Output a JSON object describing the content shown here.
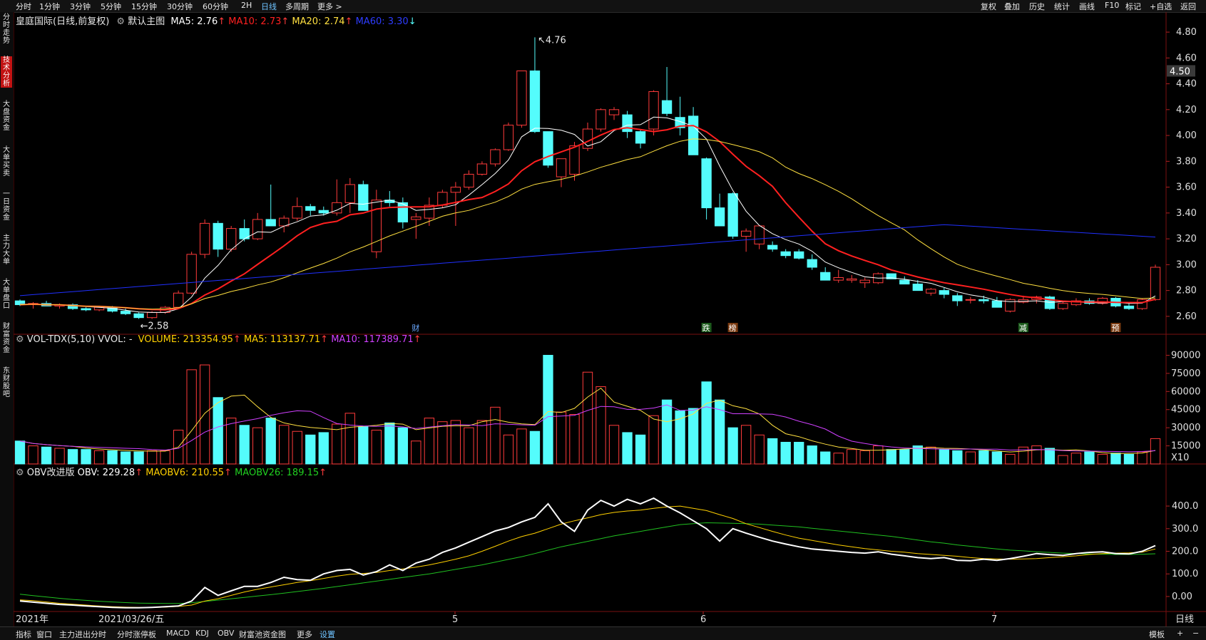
{
  "toolbar": {
    "tabs": [
      "分时",
      "1分钟",
      "3分钟",
      "5分钟",
      "15分钟",
      "30分钟",
      "60分钟",
      "2H",
      "日线",
      "多周期",
      "更多 >"
    ],
    "active": "日线",
    "right": [
      "复权",
      "叠加",
      "历史",
      "统计",
      "画线",
      "F10",
      "标记",
      "+自选",
      "返回"
    ]
  },
  "sidebar": {
    "items": [
      "分时走势",
      "技术分析",
      "大盘资金",
      "大单买卖",
      "一日资金",
      "主力大单",
      "大单盘口",
      "财富资金",
      "东财股吧"
    ],
    "active": "技术分析"
  },
  "main_panel": {
    "title": "皇庭国际(日线,前复权)",
    "subtitle": "默认主图",
    "ma5": "MA5: 2.76",
    "ma10": "MA10: 2.73",
    "ma20": "MA20: 2.74",
    "ma60": "MA60: 3.30",
    "high_label": "4.76",
    "low_label": "2.58",
    "price_ticks": [
      "4.80",
      "4.60",
      "4.40",
      "4.20",
      "4.00",
      "3.80",
      "3.60",
      "3.40",
      "3.20",
      "3.00",
      "2.80",
      "2.60"
    ],
    "last_price": "4.50",
    "events": [
      "财",
      "跌",
      "榜",
      "减",
      "预"
    ]
  },
  "volume_panel": {
    "title": "VOL-TDX(5,10) VVOL: -",
    "volume": "VOLUME: 213354.95",
    "ma5": "MA5: 113137.71",
    "ma10": "MA10: 117389.71",
    "ticks": [
      "90000",
      "75000",
      "60000",
      "45000",
      "30000",
      "15000"
    ],
    "unit": "X10"
  },
  "obv_panel": {
    "title": "OBV改进版",
    "obv": "OBV: 229.28",
    "maobv6": "MAOBV6: 210.55",
    "maobv26": "MAOBV26: 189.15",
    "ticks": [
      "400.0",
      "300.0",
      "200.0",
      "100.0",
      "0.00"
    ]
  },
  "date_axis": {
    "labels": [
      "2021年",
      "2021/03/26/五",
      "5",
      "6",
      "7"
    ],
    "period": "日线"
  },
  "bottom": {
    "left": [
      "指标",
      "窗口",
      "主力进出分时",
      "分时涨停板",
      "MACD",
      "KDJ",
      "OBV",
      "财富池资金图",
      "更多",
      "设置"
    ],
    "active": "设置",
    "right": [
      "模板",
      "+",
      "−"
    ]
  },
  "colors": {
    "up": "#ff3b3b",
    "down": "#54fcfc",
    "ma5": "#ffffff",
    "ma10": "#ff2020",
    "ma20": "#ffe040",
    "ma60": "#2030ff",
    "obv": "#ffffff",
    "maobv6": "#ffd000",
    "maobv26": "#20c020",
    "vol_ma10": "#d040ff",
    "background": "#000000"
  },
  "chart_data": {
    "type": "candlestick",
    "ohlc": [
      [
        2.72,
        2.73,
        2.68,
        2.69
      ],
      [
        2.69,
        2.71,
        2.66,
        2.7
      ],
      [
        2.7,
        2.72,
        2.68,
        2.68
      ],
      [
        2.68,
        2.7,
        2.66,
        2.69
      ],
      [
        2.69,
        2.7,
        2.65,
        2.66
      ],
      [
        2.66,
        2.67,
        2.64,
        2.65
      ],
      [
        2.65,
        2.68,
        2.64,
        2.67
      ],
      [
        2.67,
        2.68,
        2.63,
        2.64
      ],
      [
        2.64,
        2.66,
        2.61,
        2.62
      ],
      [
        2.62,
        2.63,
        2.58,
        2.59
      ],
      [
        2.59,
        2.64,
        2.58,
        2.63
      ],
      [
        2.63,
        2.68,
        2.62,
        2.67
      ],
      [
        2.67,
        2.8,
        2.66,
        2.78
      ],
      [
        2.78,
        3.1,
        2.77,
        3.08
      ],
      [
        3.08,
        3.35,
        3.05,
        3.32
      ],
      [
        3.32,
        3.34,
        3.06,
        3.12
      ],
      [
        3.12,
        3.3,
        3.1,
        3.28
      ],
      [
        3.28,
        3.35,
        3.18,
        3.2
      ],
      [
        3.2,
        3.4,
        3.19,
        3.35
      ],
      [
        3.35,
        3.62,
        3.3,
        3.3
      ],
      [
        3.3,
        3.38,
        3.25,
        3.36
      ],
      [
        3.36,
        3.52,
        3.34,
        3.45
      ],
      [
        3.45,
        3.47,
        3.38,
        3.42
      ],
      [
        3.42,
        3.45,
        3.38,
        3.4
      ],
      [
        3.4,
        3.66,
        3.38,
        3.48
      ],
      [
        3.48,
        3.67,
        3.4,
        3.62
      ],
      [
        3.62,
        3.65,
        3.42,
        3.42
      ],
      [
        3.1,
        3.58,
        3.05,
        3.5
      ],
      [
        3.5,
        3.57,
        3.45,
        3.48
      ],
      [
        3.48,
        3.52,
        3.28,
        3.33
      ],
      [
        3.35,
        3.4,
        3.2,
        3.37
      ],
      [
        3.36,
        3.52,
        3.3,
        3.46
      ],
      [
        3.46,
        3.58,
        3.44,
        3.56
      ],
      [
        3.56,
        3.64,
        3.3,
        3.6
      ],
      [
        3.6,
        3.73,
        3.58,
        3.7
      ],
      [
        3.7,
        3.8,
        3.69,
        3.78
      ],
      [
        3.78,
        3.9,
        3.76,
        3.89
      ],
      [
        3.89,
        4.1,
        3.88,
        4.08
      ],
      [
        4.08,
        4.5,
        4.06,
        4.5
      ],
      [
        4.5,
        4.76,
        4.02,
        4.03
      ],
      [
        4.03,
        4.03,
        3.75,
        3.77
      ],
      [
        3.68,
        3.8,
        3.6,
        3.82
      ],
      [
        3.7,
        3.95,
        3.65,
        3.92
      ],
      [
        3.9,
        4.1,
        3.88,
        4.05
      ],
      [
        4.05,
        4.21,
        4.03,
        4.2
      ],
      [
        4.16,
        4.22,
        4.12,
        4.2
      ],
      [
        4.16,
        4.19,
        3.98,
        4.03
      ],
      [
        4.03,
        4.05,
        3.9,
        3.94
      ],
      [
        4.05,
        4.35,
        4.0,
        4.34
      ],
      [
        4.27,
        4.53,
        4.15,
        4.17
      ],
      [
        4.14,
        4.3,
        4.0,
        4.06
      ],
      [
        4.15,
        4.22,
        3.85,
        3.85
      ],
      [
        3.82,
        3.83,
        3.35,
        3.44
      ],
      [
        3.44,
        3.55,
        3.3,
        3.3
      ],
      [
        3.55,
        3.56,
        3.2,
        3.22
      ],
      [
        3.22,
        3.28,
        3.1,
        3.26
      ],
      [
        3.16,
        3.3,
        3.12,
        3.3
      ],
      [
        3.15,
        3.18,
        3.1,
        3.12
      ],
      [
        3.1,
        3.12,
        3.05,
        3.07
      ],
      [
        3.1,
        3.12,
        3.04,
        3.05
      ],
      [
        3.04,
        3.08,
        2.96,
        2.98
      ],
      [
        2.94,
        2.98,
        2.88,
        2.88
      ],
      [
        2.88,
        2.96,
        2.86,
        2.9
      ],
      [
        2.88,
        2.92,
        2.86,
        2.89
      ],
      [
        2.86,
        2.9,
        2.82,
        2.88
      ],
      [
        2.86,
        2.94,
        2.85,
        2.93
      ],
      [
        2.93,
        2.93,
        2.89,
        2.89
      ],
      [
        2.88,
        2.91,
        2.85,
        2.85
      ],
      [
        2.85,
        2.88,
        2.8,
        2.8
      ],
      [
        2.78,
        2.82,
        2.76,
        2.81
      ],
      [
        2.8,
        2.82,
        2.74,
        2.77
      ],
      [
        2.76,
        2.78,
        2.68,
        2.72
      ],
      [
        2.73,
        2.75,
        2.7,
        2.73
      ],
      [
        2.73,
        2.76,
        2.7,
        2.72
      ],
      [
        2.72,
        2.75,
        2.67,
        2.67
      ],
      [
        2.64,
        2.74,
        2.63,
        2.73
      ],
      [
        2.71,
        2.76,
        2.7,
        2.73
      ],
      [
        2.73,
        2.76,
        2.7,
        2.75
      ],
      [
        2.75,
        2.76,
        2.65,
        2.66
      ],
      [
        2.66,
        2.72,
        2.65,
        2.7
      ],
      [
        2.69,
        2.74,
        2.68,
        2.72
      ],
      [
        2.72,
        2.74,
        2.69,
        2.7
      ],
      [
        2.7,
        2.75,
        2.69,
        2.74
      ],
      [
        2.74,
        2.75,
        2.67,
        2.68
      ],
      [
        2.68,
        2.7,
        2.65,
        2.66
      ],
      [
        2.66,
        2.74,
        2.65,
        2.73
      ],
      [
        2.73,
        3.0,
        2.72,
        2.98
      ]
    ],
    "volume": [
      19000,
      15000,
      14000,
      13000,
      12000,
      12000,
      11000,
      11000,
      10000,
      10000,
      11000,
      11000,
      28000,
      78000,
      82000,
      55000,
      38000,
      32000,
      30000,
      38000,
      32000,
      27000,
      24000,
      26000,
      33000,
      42000,
      31000,
      28000,
      34000,
      30000,
      19000,
      38000,
      35000,
      36000,
      30000,
      36000,
      47000,
      24000,
      29000,
      27000,
      90000,
      43000,
      41000,
      76000,
      64000,
      32000,
      26000,
      24000,
      40000,
      53000,
      44000,
      46000,
      68000,
      53000,
      30000,
      32000,
      24000,
      21000,
      18000,
      18000,
      15000,
      10000,
      9000,
      12000,
      11000,
      15000,
      12000,
      12000,
      15000,
      14000,
      12000,
      11000,
      10000,
      11000,
      10000,
      8000,
      14000,
      15000,
      13000,
      7000,
      9000,
      10000,
      8000,
      9000,
      8000,
      10000,
      21000
    ],
    "ma_lines": [
      "MA5",
      "MA10",
      "MA20",
      "MA60"
    ],
    "y_range": [
      2.5,
      4.85
    ],
    "volume_range": [
      0,
      95000
    ],
    "obv_range": [
      -60,
      520
    ],
    "obv": [
      -20,
      -25,
      -30,
      -35,
      -38,
      -42,
      -45,
      -48,
      -50,
      -50,
      -48,
      -45,
      -42,
      -20,
      40,
      5,
      25,
      45,
      45,
      62,
      85,
      75,
      72,
      100,
      115,
      120,
      95,
      110,
      140,
      115,
      148,
      165,
      195,
      215,
      240,
      265,
      290,
      305,
      330,
      350,
      410,
      330,
      288,
      382,
      425,
      400,
      430,
      410,
      435,
      400,
      370,
      335,
      300,
      245,
      300,
      280,
      262,
      245,
      232,
      220,
      210,
      205,
      200,
      195,
      192,
      198,
      187,
      180,
      172,
      168,
      172,
      160,
      158,
      165,
      160,
      168,
      178,
      190,
      185,
      182,
      190,
      195,
      198,
      190,
      188,
      200,
      225
    ],
    "maobv6": [
      -15,
      -18,
      -24,
      -30,
      -34,
      -38,
      -42,
      -45,
      -47,
      -48,
      -49,
      -47,
      -44,
      -38,
      -20,
      -10,
      5,
      20,
      32,
      42,
      52,
      62,
      70,
      80,
      90,
      98,
      102,
      106,
      115,
      122,
      130,
      140,
      152,
      165,
      180,
      200,
      222,
      245,
      265,
      280,
      300,
      320,
      335,
      348,
      362,
      372,
      378,
      382,
      390,
      396,
      400,
      390,
      380,
      362,
      345,
      322,
      305,
      288,
      272,
      258,
      248,
      238,
      228,
      220,
      212,
      206,
      200,
      196,
      190,
      186,
      182,
      178,
      172,
      168,
      166,
      165,
      166,
      168,
      172,
      176,
      180,
      186,
      190,
      192,
      193,
      196,
      210
    ],
    "maobv26": [
      10,
      4,
      -2,
      -8,
      -13,
      -17,
      -21,
      -24,
      -27,
      -29,
      -30,
      -31,
      -31,
      -28,
      -22,
      -16,
      -10,
      -4,
      2,
      8,
      15,
      22,
      29,
      36,
      44,
      52,
      60,
      68,
      76,
      84,
      92,
      100,
      110,
      120,
      130,
      140,
      152,
      164,
      176,
      190,
      205,
      220,
      232,
      244,
      256,
      268,
      278,
      288,
      298,
      308,
      318,
      322,
      326,
      325,
      324,
      322,
      320,
      316,
      312,
      308,
      302,
      296,
      290,
      284,
      278,
      272,
      266,
      258,
      250,
      242,
      236,
      228,
      222,
      216,
      210,
      205,
      202,
      198,
      195,
      192,
      190,
      188,
      187,
      186,
      186,
      187,
      189
    ]
  }
}
